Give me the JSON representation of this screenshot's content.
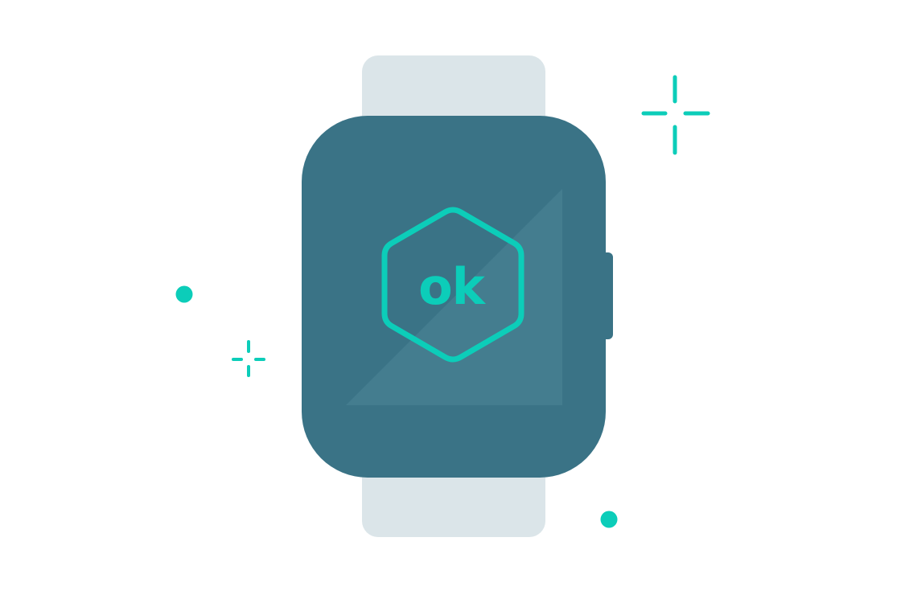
{
  "watch": {
    "badge_text": "ok"
  },
  "colors": {
    "background": "#ffffff",
    "strap": "#dbe5e9",
    "case": "#3a7386",
    "screen_highlight": "#447d8f",
    "accent": "#0ccdb9"
  },
  "icons": [
    "hexagon-badge-icon",
    "sparkle-icon",
    "dot-icon"
  ]
}
